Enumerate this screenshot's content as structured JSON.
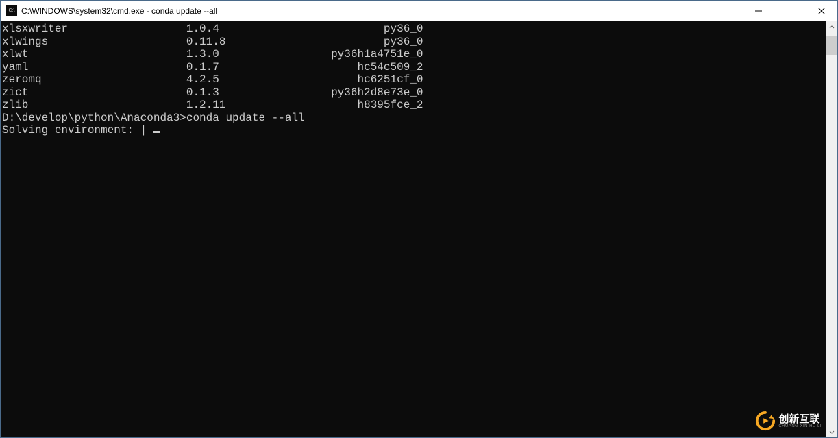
{
  "window": {
    "title": "C:\\WINDOWS\\system32\\cmd.exe - conda  update --all"
  },
  "terminal": {
    "packages": [
      {
        "name": "xlsxwriter",
        "version": "1.0.4",
        "build": "py36_0"
      },
      {
        "name": "xlwings",
        "version": "0.11.8",
        "build": "py36_0"
      },
      {
        "name": "xlwt",
        "version": "1.3.0",
        "build": "py36h1a4751e_0"
      },
      {
        "name": "yaml",
        "version": "0.1.7",
        "build": "hc54c509_2"
      },
      {
        "name": "zeromq",
        "version": "4.2.5",
        "build": "hc6251cf_0"
      },
      {
        "name": "zict",
        "version": "0.1.3",
        "build": "py36h2d8e73e_0"
      },
      {
        "name": "zlib",
        "version": "1.2.11",
        "build": "h8395fce_2"
      }
    ],
    "prompt_path": "D:\\develop\\python\\Anaconda3>",
    "command": "conda update --all",
    "status_line": "Solving environment: | "
  },
  "watermark": {
    "main": "创新互联",
    "sub": "CHUANG XIN HU LI"
  }
}
